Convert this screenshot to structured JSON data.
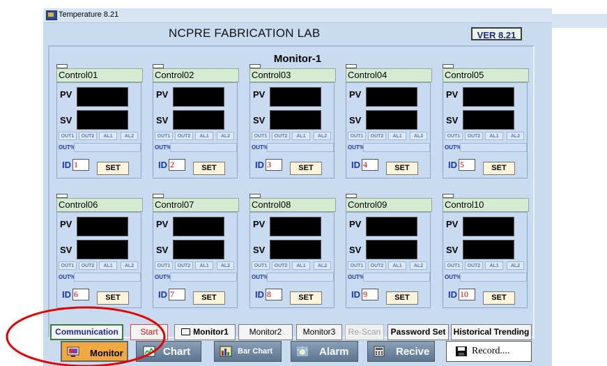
{
  "window": {
    "title": "Temperature 8.21"
  },
  "header": {
    "lab_name": "NCPRE FABRICATION LAB",
    "version": "VER 8.21"
  },
  "monitor_title": "Monitor-1",
  "controller_labels": {
    "pv": "PV",
    "sv": "SV",
    "leds": [
      "OUT1",
      "OUT2",
      "AL1",
      "AL2"
    ],
    "out_percent": "OUT%",
    "id": "ID",
    "set": "SET"
  },
  "controllers": [
    {
      "name": "Control01",
      "id": "1"
    },
    {
      "name": "Control02",
      "id": "2"
    },
    {
      "name": "Control03",
      "id": "3"
    },
    {
      "name": "Control04",
      "id": "4"
    },
    {
      "name": "Control05",
      "id": "5"
    },
    {
      "name": "Control06",
      "id": "6"
    },
    {
      "name": "Control07",
      "id": "7"
    },
    {
      "name": "Control08",
      "id": "8"
    },
    {
      "name": "Control09",
      "id": "9"
    },
    {
      "name": "Control10",
      "id": "10"
    }
  ],
  "action_buttons": {
    "communication": "Communication",
    "start": "Start",
    "monitor1": "Monitor1",
    "monitor2": "Monitor2",
    "monitor3": "Monitor3",
    "rescan": "Re-Scan",
    "password_set": "Password Set",
    "historical_trending": "Historical Trending"
  },
  "nav_buttons": {
    "monitor": "Monitor",
    "chart": "Chart",
    "bar_chart": "Bar Chart",
    "alarm": "Alarm",
    "recive": "Recive",
    "record": "Record...."
  },
  "colors": {
    "window_bg": "#c8dbf0",
    "control_header": "#d5ecd2",
    "display_bg": "#000000",
    "id_value": "#d00000",
    "set_button": "#fdf4dc",
    "monitor_nav_active": "#f0a840",
    "highlight": "#e00000"
  }
}
